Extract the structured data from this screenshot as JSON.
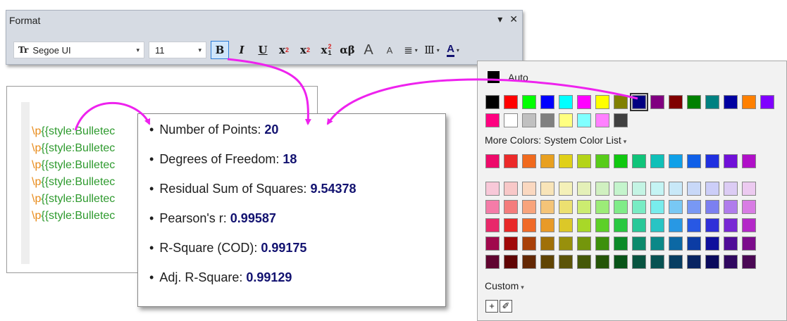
{
  "toolbar": {
    "title": "Format",
    "pin_glyph": "▾",
    "close_glyph": "✕",
    "font_icon": "Tr",
    "font_name": "Segoe UI",
    "font_size": "11",
    "combo_arrow": "▾",
    "buttons": {
      "bold": "B",
      "italic": "I",
      "underline": "U",
      "superscript_base": "x",
      "superscript_mark": "2",
      "subscript_base": "x",
      "subscript_mark": "2",
      "supsub_base": "x",
      "supsub_top": "2",
      "supsub_bottom": "1",
      "greek": "αβ",
      "grow_font": "A",
      "shrink_font": "A",
      "align": "≣",
      "columns": "Ⅲ",
      "font_color": "A"
    }
  },
  "source": {
    "lines": [
      {
        "esc": "\\p",
        "text": "{{style:Bulletec"
      },
      {
        "esc": "\\p",
        "text": "{{style:Bulletec"
      },
      {
        "esc": "\\p",
        "text": "{{style:Bulletec"
      },
      {
        "esc": "\\p",
        "text": "{{style:Bulletec"
      },
      {
        "esc": "\\p",
        "text": "{{style:Bulletec"
      },
      {
        "esc": "\\p",
        "text": "{{style:Bulletec"
      }
    ]
  },
  "label": {
    "bullet": "•",
    "items": [
      {
        "label": "Number of Points: ",
        "value": "20"
      },
      {
        "label": "Degrees of Freedom: ",
        "value": "18"
      },
      {
        "label": "Residual Sum of Squares: ",
        "value": "9.54378"
      },
      {
        "label": "Pearson's r: ",
        "value": "0.99587"
      },
      {
        "label": "R-Square (COD): ",
        "value": "0.99175"
      },
      {
        "label": "Adj. R-Square: ",
        "value": "0.99129"
      }
    ]
  },
  "color_picker": {
    "auto_label": "Auto",
    "more_colors_label": "More Colors: System Color List",
    "custom_label": "Custom",
    "caret": "▾",
    "add_glyph": "+",
    "eyedropper_glyph": "✐",
    "selected_color": "#000080",
    "system_colors": [
      "#000000",
      "#ff0000",
      "#00ff00",
      "#0000ff",
      "#00ffff",
      "#ff00ff",
      "#ffff00",
      "#808000",
      "#000080",
      "#800080",
      "#800000",
      "#008000",
      "#008080",
      "#0000a0",
      "#ff8000",
      "#8000ff",
      "#ff0080",
      "#ffffff",
      "#c0c0c0",
      "#808080",
      "#ffff80",
      "#80ffff",
      "#ff80ff",
      "#404040"
    ],
    "palette_rows": [
      [
        "#ee0a6a",
        "#ec2a2a",
        "#f06a1e",
        "#e8a020",
        "#e0d018",
        "#b4d418",
        "#58cc1a",
        "#10c810",
        "#10c47a",
        "#10c0b8",
        "#10a0e8",
        "#1060e8",
        "#2030e0",
        "#7010d8",
        "#b010c8"
      ],
      [
        "#f8c8d8",
        "#f8c8c8",
        "#fad8c0",
        "#f8e4b8",
        "#f4f0b8",
        "#e4f0b8",
        "#d0f0c0",
        "#c4f4cc",
        "#c4f4e4",
        "#c4f4f4",
        "#c8e8f8",
        "#c8d8f8",
        "#cccef8",
        "#dcccf4",
        "#eccaf0"
      ],
      [
        "#f47ca8",
        "#f47c7c",
        "#f8a47c",
        "#f4c478",
        "#ece070",
        "#ccec70",
        "#9cec78",
        "#80ec88",
        "#78ecc4",
        "#78ecec",
        "#78c8f4",
        "#7898f4",
        "#7c80f0",
        "#b07cec",
        "#d87ce4"
      ],
      [
        "#e8286a",
        "#e82828",
        "#f06a28",
        "#e89a28",
        "#dcc828",
        "#a8d828",
        "#5cd028",
        "#28c840",
        "#28c898",
        "#28c4c4",
        "#2898e4",
        "#2858e4",
        "#3030d8",
        "#7828d4",
        "#b428c8"
      ],
      [
        "#a0084c",
        "#a00808",
        "#a84008",
        "#a07008",
        "#98900c",
        "#74960c",
        "#3c900c",
        "#0c8a28",
        "#0c8a6c",
        "#0c8888",
        "#0c68a4",
        "#0c3ca4",
        "#10109c",
        "#500c98",
        "#7c0c8c"
      ],
      [
        "#600430",
        "#600404",
        "#642804",
        "#604404",
        "#5c5408",
        "#445808",
        "#245408",
        "#085418",
        "#085440",
        "#085252",
        "#083e62",
        "#082462",
        "#0a0a5c",
        "#300860",
        "#4a0854"
      ]
    ]
  }
}
